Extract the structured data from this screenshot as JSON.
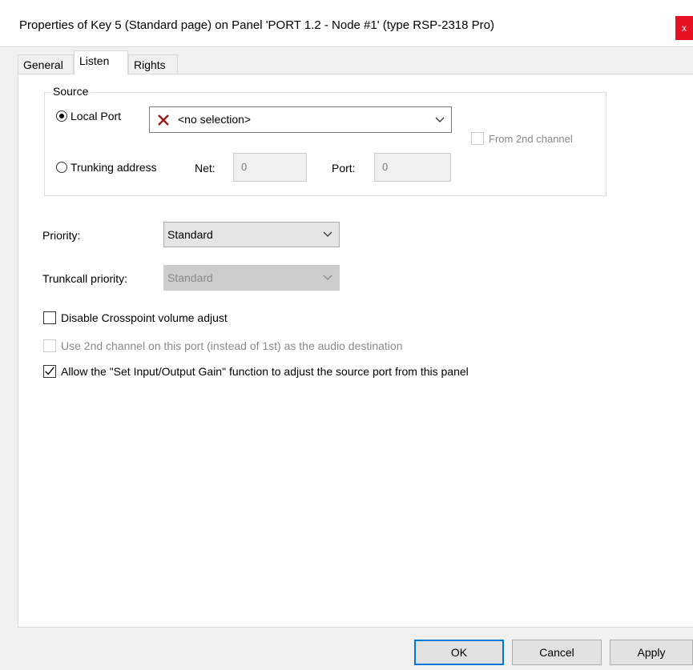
{
  "window": {
    "title": "Properties of Key 5 (Standard page) on Panel 'PORT 1.2 - Node #1' (type RSP-2318 Pro)",
    "close_label": "x"
  },
  "tabs": [
    {
      "label": "General",
      "active": false
    },
    {
      "label": "Listen",
      "active": true
    },
    {
      "label": "Rights",
      "active": false
    }
  ],
  "source": {
    "group_label": "Source",
    "local_port_label": "Local Port",
    "local_port_selected": true,
    "local_port_value": "<no selection>",
    "from_2nd_channel_label": "From 2nd channel",
    "trunking_label": "Trunking address",
    "net_label": "Net:",
    "net_value": "0",
    "port_label": "Port:",
    "port_value": "0"
  },
  "priority": {
    "label": "Priority:",
    "value": "Standard"
  },
  "trunkcall_priority": {
    "label": "Trunkcall priority:",
    "value": "Standard"
  },
  "options": {
    "disable_crosspoint_label": "Disable Crosspoint volume adjust",
    "disable_crosspoint_checked": false,
    "use_2nd_channel_label": "Use 2nd channel on this port (instead of 1st) as the audio destination",
    "use_2nd_channel_checked": false,
    "allow_gain_label": "Allow the \"Set Input/Output Gain\" function to adjust the source port from this panel",
    "allow_gain_checked": true
  },
  "buttons": {
    "ok": "OK",
    "cancel": "Cancel",
    "apply": "Apply"
  },
  "colors": {
    "accent": "#0078d7",
    "close": "#e81123",
    "x_mark": "#9b1b1b"
  }
}
